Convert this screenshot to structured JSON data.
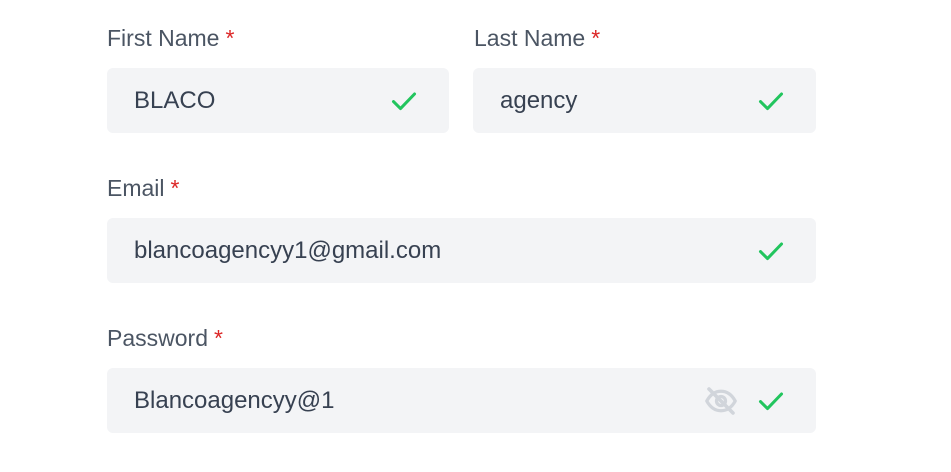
{
  "form": {
    "first_name": {
      "label": "First Name",
      "required_mark": "*",
      "value": "BLACO",
      "status_icon": "check-icon"
    },
    "last_name": {
      "label": "Last Name",
      "required_mark": "*",
      "value": "agency",
      "status_icon": "check-icon"
    },
    "email": {
      "label": "Email",
      "required_mark": "*",
      "value": "blancoagencyy1@gmail.com",
      "status_icon": "check-icon"
    },
    "password": {
      "label": "Password",
      "required_mark": "*",
      "value": "Blancoagencyy@1",
      "visibility_icon": "eye-slash-icon",
      "status_icon": "check-icon"
    }
  },
  "colors": {
    "label": "#4b5563",
    "required": "#dc2626",
    "input_bg": "#f3f4f6",
    "input_text": "#374151",
    "valid": "#22c55e",
    "icon_muted": "#d1d5db"
  }
}
